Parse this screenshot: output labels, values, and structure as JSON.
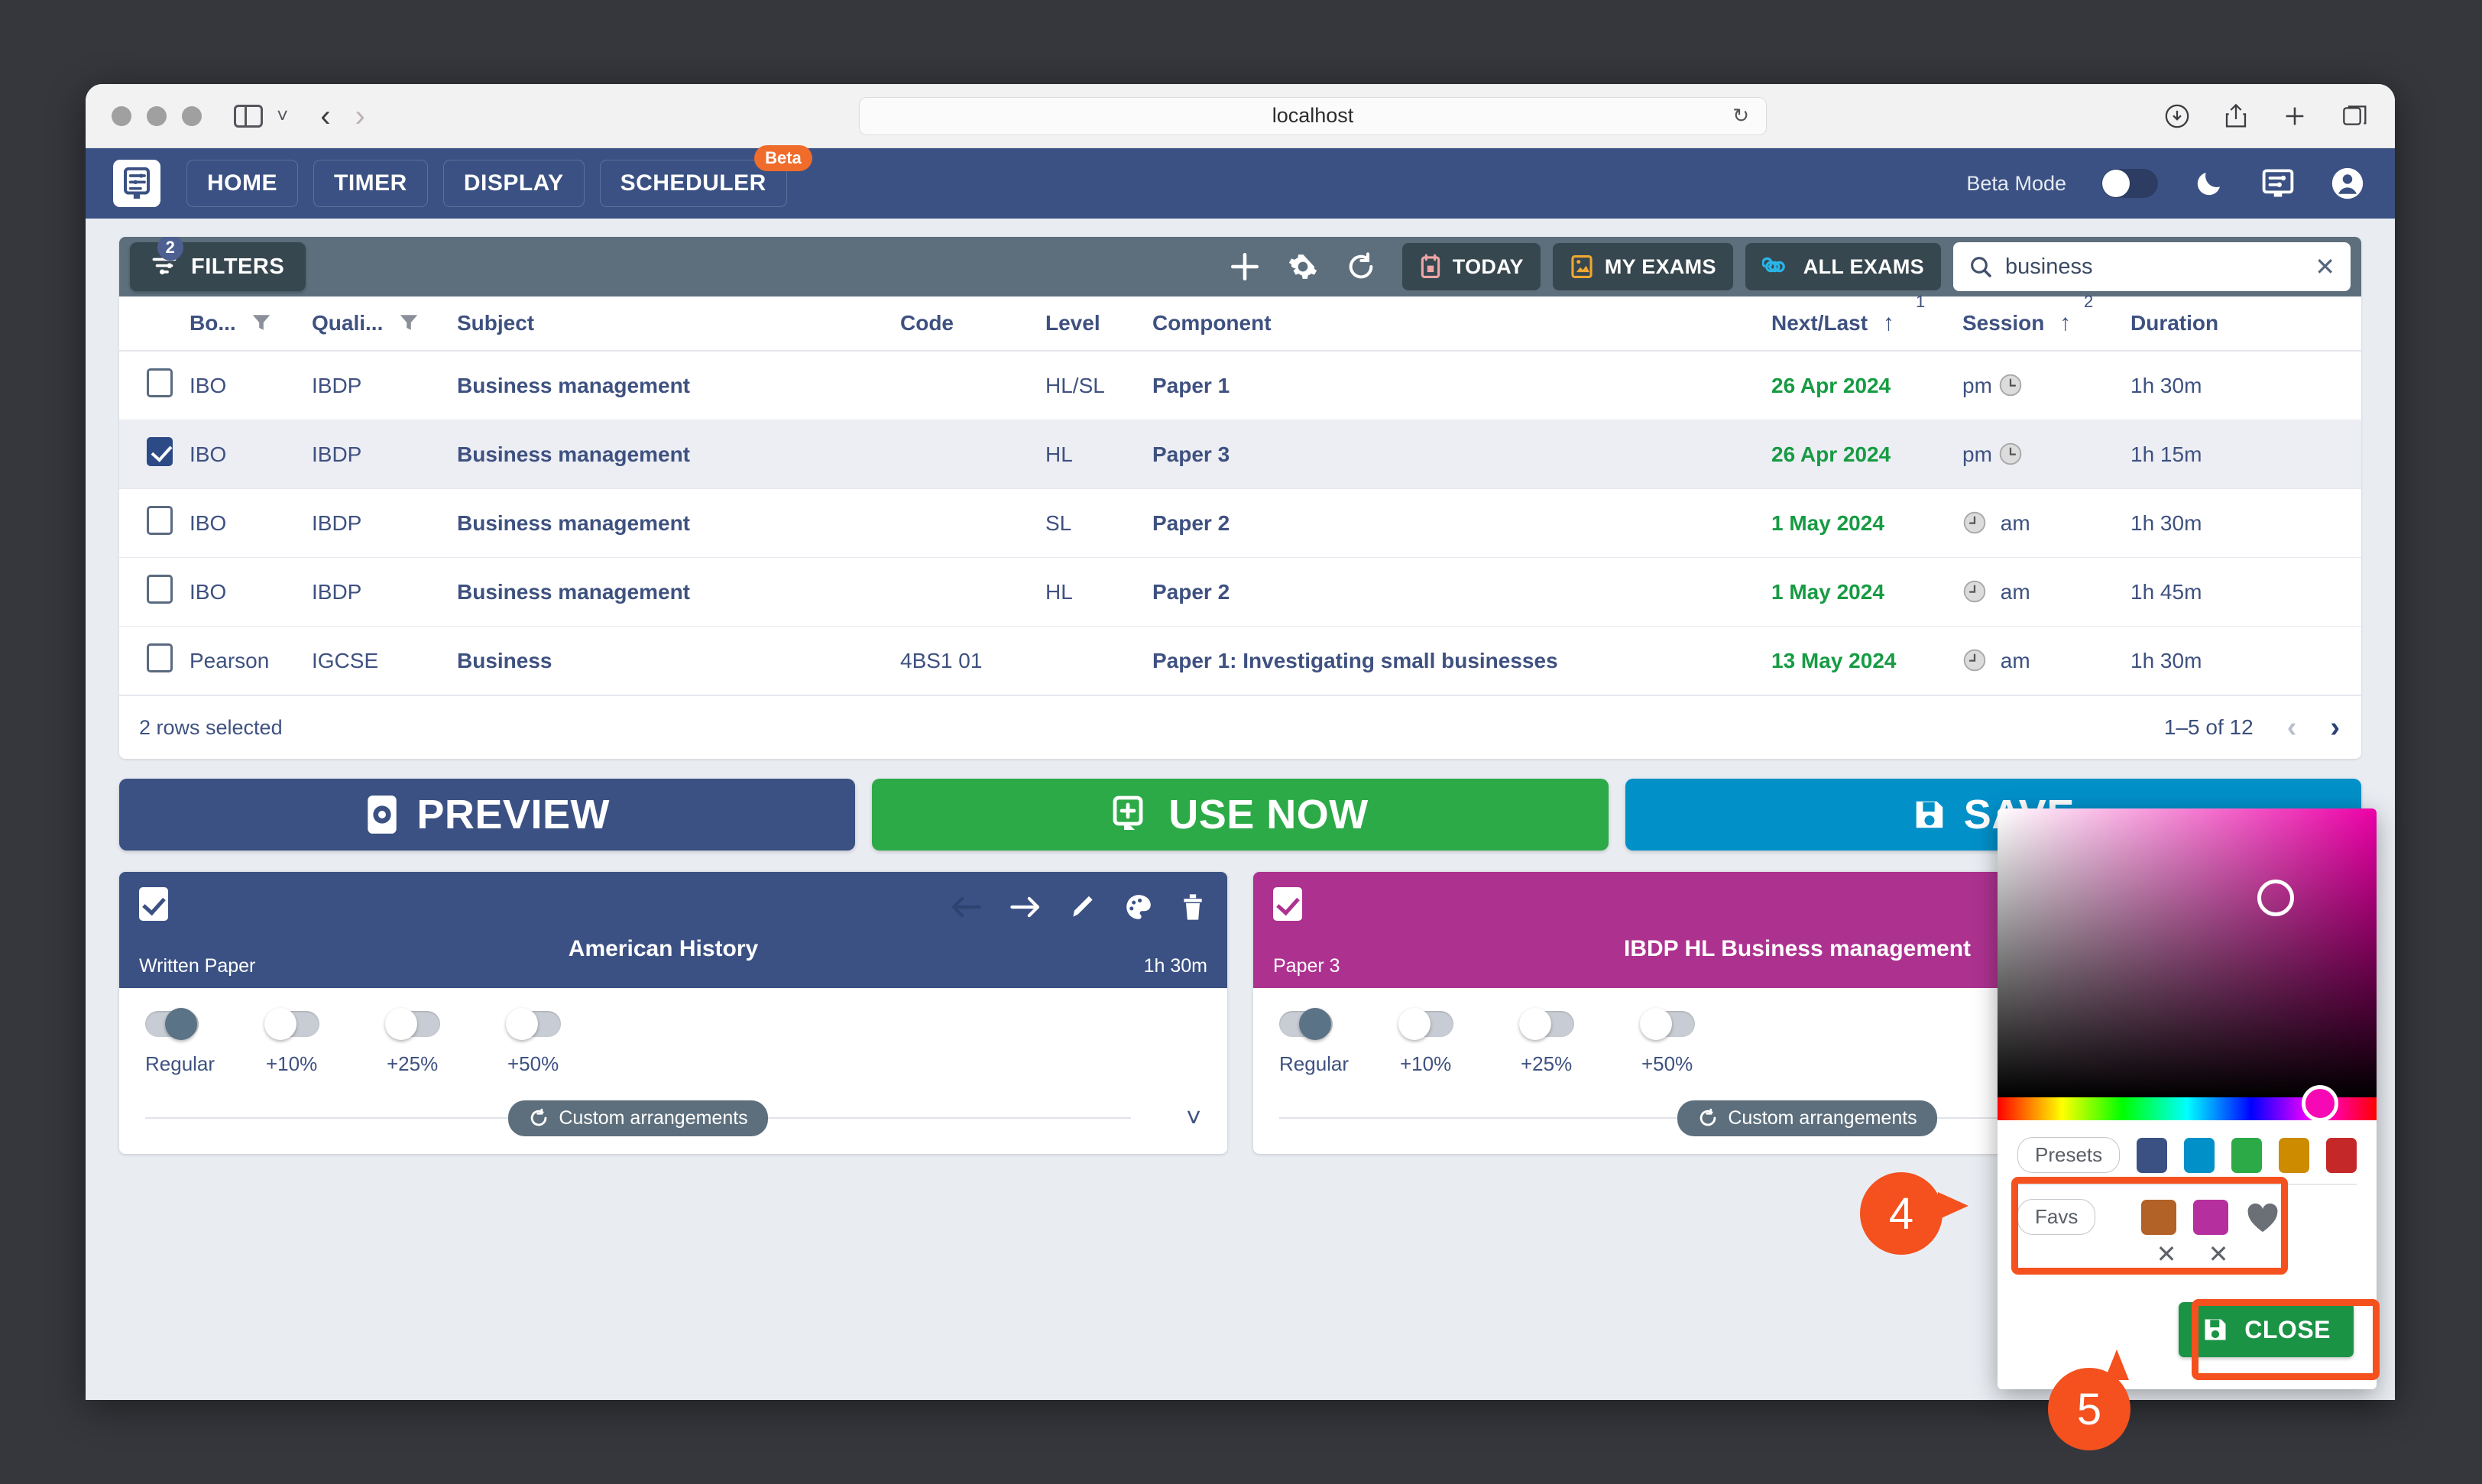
{
  "browser": {
    "url": "localhost",
    "icons": [
      "sidebar-icon",
      "chevron-down-icon",
      "back-arrow-icon",
      "forward-arrow-icon",
      "reload-icon",
      "download-icon",
      "share-icon",
      "new-tab-icon",
      "tabs-icon"
    ]
  },
  "appbar": {
    "logo": "scheduler-logo-icon",
    "nav": [
      {
        "label": "HOME",
        "badge": ""
      },
      {
        "label": "TIMER",
        "badge": ""
      },
      {
        "label": "DISPLAY",
        "badge": ""
      },
      {
        "label": "SCHEDULER",
        "badge": "Beta"
      }
    ],
    "beta_mode_label": "Beta Mode",
    "beta_mode_on": false,
    "right_icons": [
      "moon-icon",
      "display-icon",
      "account-icon"
    ]
  },
  "toolbar": {
    "filters_label": "FILTERS",
    "filters_count": "2",
    "add_label": "add-icon",
    "settings_label": "gear-icon",
    "reset_label": "reset-icon",
    "today_label": "TODAY",
    "my_exams_label": "MY EXAMS",
    "all_exams_label": "ALL EXAMS",
    "search_value": "business",
    "search_clear": "✕"
  },
  "table": {
    "columns": [
      {
        "key": "check",
        "label": ""
      },
      {
        "key": "board",
        "label": "Bo...",
        "filter": true
      },
      {
        "key": "qual",
        "label": "Quali...",
        "filter": true
      },
      {
        "key": "subject",
        "label": "Subject"
      },
      {
        "key": "code",
        "label": "Code"
      },
      {
        "key": "level",
        "label": "Level"
      },
      {
        "key": "component",
        "label": "Component"
      },
      {
        "key": "next",
        "label": "Next/Last",
        "sort": "asc",
        "sort_order": "1"
      },
      {
        "key": "session",
        "label": "Session",
        "sort": "asc",
        "sort_order": "2"
      },
      {
        "key": "duration",
        "label": "Duration"
      }
    ],
    "rows": [
      {
        "checked": false,
        "board": "IBO",
        "qual": "IBDP",
        "subject": "Business management",
        "code": "",
        "level": "HL/SL",
        "component": "Paper 1",
        "next": "26 Apr 2024",
        "session": "pm",
        "session_side": "right",
        "duration": "1h 30m"
      },
      {
        "checked": true,
        "board": "IBO",
        "qual": "IBDP",
        "subject": "Business management",
        "code": "",
        "level": "HL",
        "component": "Paper 3",
        "next": "26 Apr 2024",
        "session": "pm",
        "session_side": "right",
        "duration": "1h 15m"
      },
      {
        "checked": false,
        "board": "IBO",
        "qual": "IBDP",
        "subject": "Business management",
        "code": "",
        "level": "SL",
        "component": "Paper 2",
        "next": "1 May 2024",
        "session": "am",
        "session_side": "left",
        "duration": "1h 30m"
      },
      {
        "checked": false,
        "board": "IBO",
        "qual": "IBDP",
        "subject": "Business management",
        "code": "",
        "level": "HL",
        "component": "Paper 2",
        "next": "1 May 2024",
        "session": "am",
        "session_side": "left",
        "duration": "1h 45m"
      },
      {
        "checked": false,
        "board": "Pearson",
        "qual": "IGCSE",
        "subject": "Business",
        "code": "4BS1 01",
        "level": "",
        "component": "Paper 1: Investigating small businesses",
        "next": "13 May 2024",
        "session": "am",
        "session_side": "left",
        "duration": "1h 30m"
      }
    ],
    "rows_selected": "2 rows selected",
    "page_range": "1–5 of 12"
  },
  "actions": [
    {
      "label": "PREVIEW",
      "icon": "preview-icon",
      "color": "#3b5183"
    },
    {
      "label": "USE NOW",
      "icon": "use-now-icon",
      "color": "#2caa47"
    },
    {
      "label": "SAVE",
      "icon": "save-icon",
      "color": "#0290c9"
    }
  ],
  "exam_cards": [
    {
      "checked": true,
      "title": "American History",
      "component": "Written Paper",
      "duration": "1h 30m",
      "header_color": "#3b5183",
      "icons": [
        "back-arrow-icon",
        "forward-arrow-icon",
        "edit-pencil-icon",
        "palette-icon",
        "trash-icon"
      ],
      "toggles": [
        {
          "label": "Regular",
          "on": true
        },
        {
          "label": "+10%",
          "on": false
        },
        {
          "label": "+25%",
          "on": false
        },
        {
          "label": "+50%",
          "on": false
        }
      ],
      "custom_label": "Custom arrangements",
      "expand_icon": "chevron-down-icon"
    },
    {
      "checked": true,
      "title": "IBDP HL Business management",
      "component": "Paper 3",
      "duration": "",
      "header_color": "#ad3290",
      "icons": [],
      "toggles": [
        {
          "label": "Regular",
          "on": true
        },
        {
          "label": "+10%",
          "on": false
        },
        {
          "label": "+25%",
          "on": false
        },
        {
          "label": "+50%",
          "on": false
        }
      ],
      "custom_label": "Custom arrangements",
      "expand_icon": ""
    }
  ],
  "color_picker": {
    "presets_label": "Presets",
    "presets": [
      "#3b5183",
      "#0290c9",
      "#2caa47",
      "#cd8b00",
      "#c52828"
    ],
    "favs_label": "Favs",
    "favs": [
      "#b26127",
      "#b5309e"
    ],
    "fav_heart_icon": "heart-icon",
    "fav_remove_icon": "✕",
    "close_label": "CLOSE",
    "close_icon": "save-icon",
    "selected_color": "#9c2b7d",
    "hue_color": "#f609b4"
  },
  "annotations": [
    {
      "number": "4",
      "target": "favs-section"
    },
    {
      "number": "5",
      "target": "close-button"
    }
  ]
}
